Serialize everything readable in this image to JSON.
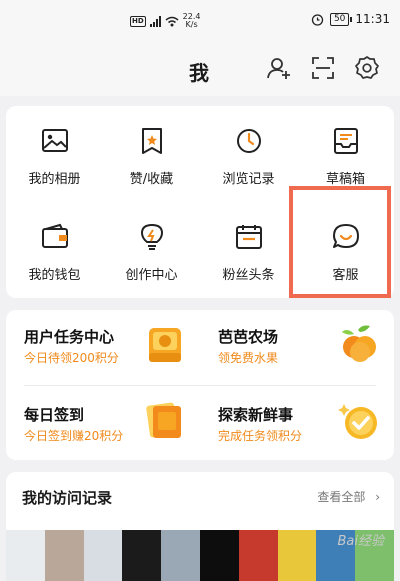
{
  "status_bar": {
    "network_badge": "HD",
    "speed_value": "22.4",
    "speed_unit": "K/s",
    "battery": "50",
    "time": "11:31"
  },
  "header": {
    "title": "我",
    "icons": [
      "add-friend-icon",
      "scan-icon",
      "settings-icon"
    ]
  },
  "grid": {
    "items": [
      {
        "label": "我的相册",
        "icon": "photo-album-icon"
      },
      {
        "label": "赞/收藏",
        "icon": "like-favorite-icon"
      },
      {
        "label": "浏览记录",
        "icon": "history-clock-icon"
      },
      {
        "label": "草稿箱",
        "icon": "drafts-tray-icon"
      },
      {
        "label": "我的钱包",
        "icon": "wallet-icon"
      },
      {
        "label": "创作中心",
        "icon": "creation-bulb-icon"
      },
      {
        "label": "粉丝头条",
        "icon": "fans-headline-icon"
      },
      {
        "label": "客服",
        "icon": "customer-service-chat-icon"
      }
    ]
  },
  "tasks": [
    {
      "title": "用户任务中心",
      "subtitle": "今日待领200积分",
      "icon": "gold-coin-icon"
    },
    {
      "title": "芭芭农场",
      "subtitle": "领免费水果",
      "icon": "fruit-icon"
    },
    {
      "title": "每日签到",
      "subtitle": "今日签到赚20积分",
      "icon": "checkin-card-icon"
    },
    {
      "title": "探索新鲜事",
      "subtitle": "完成任务领积分",
      "icon": "check-medal-icon"
    }
  ],
  "visit_history": {
    "title": "我的访问记录",
    "view_all": "查看全部",
    "chevron": "chevron-right-icon"
  },
  "watermark": "Bai经验",
  "colors": {
    "accent_orange": "#f08a1c",
    "highlight_border": "#ef6a4e",
    "background": "#f1f1f3"
  }
}
